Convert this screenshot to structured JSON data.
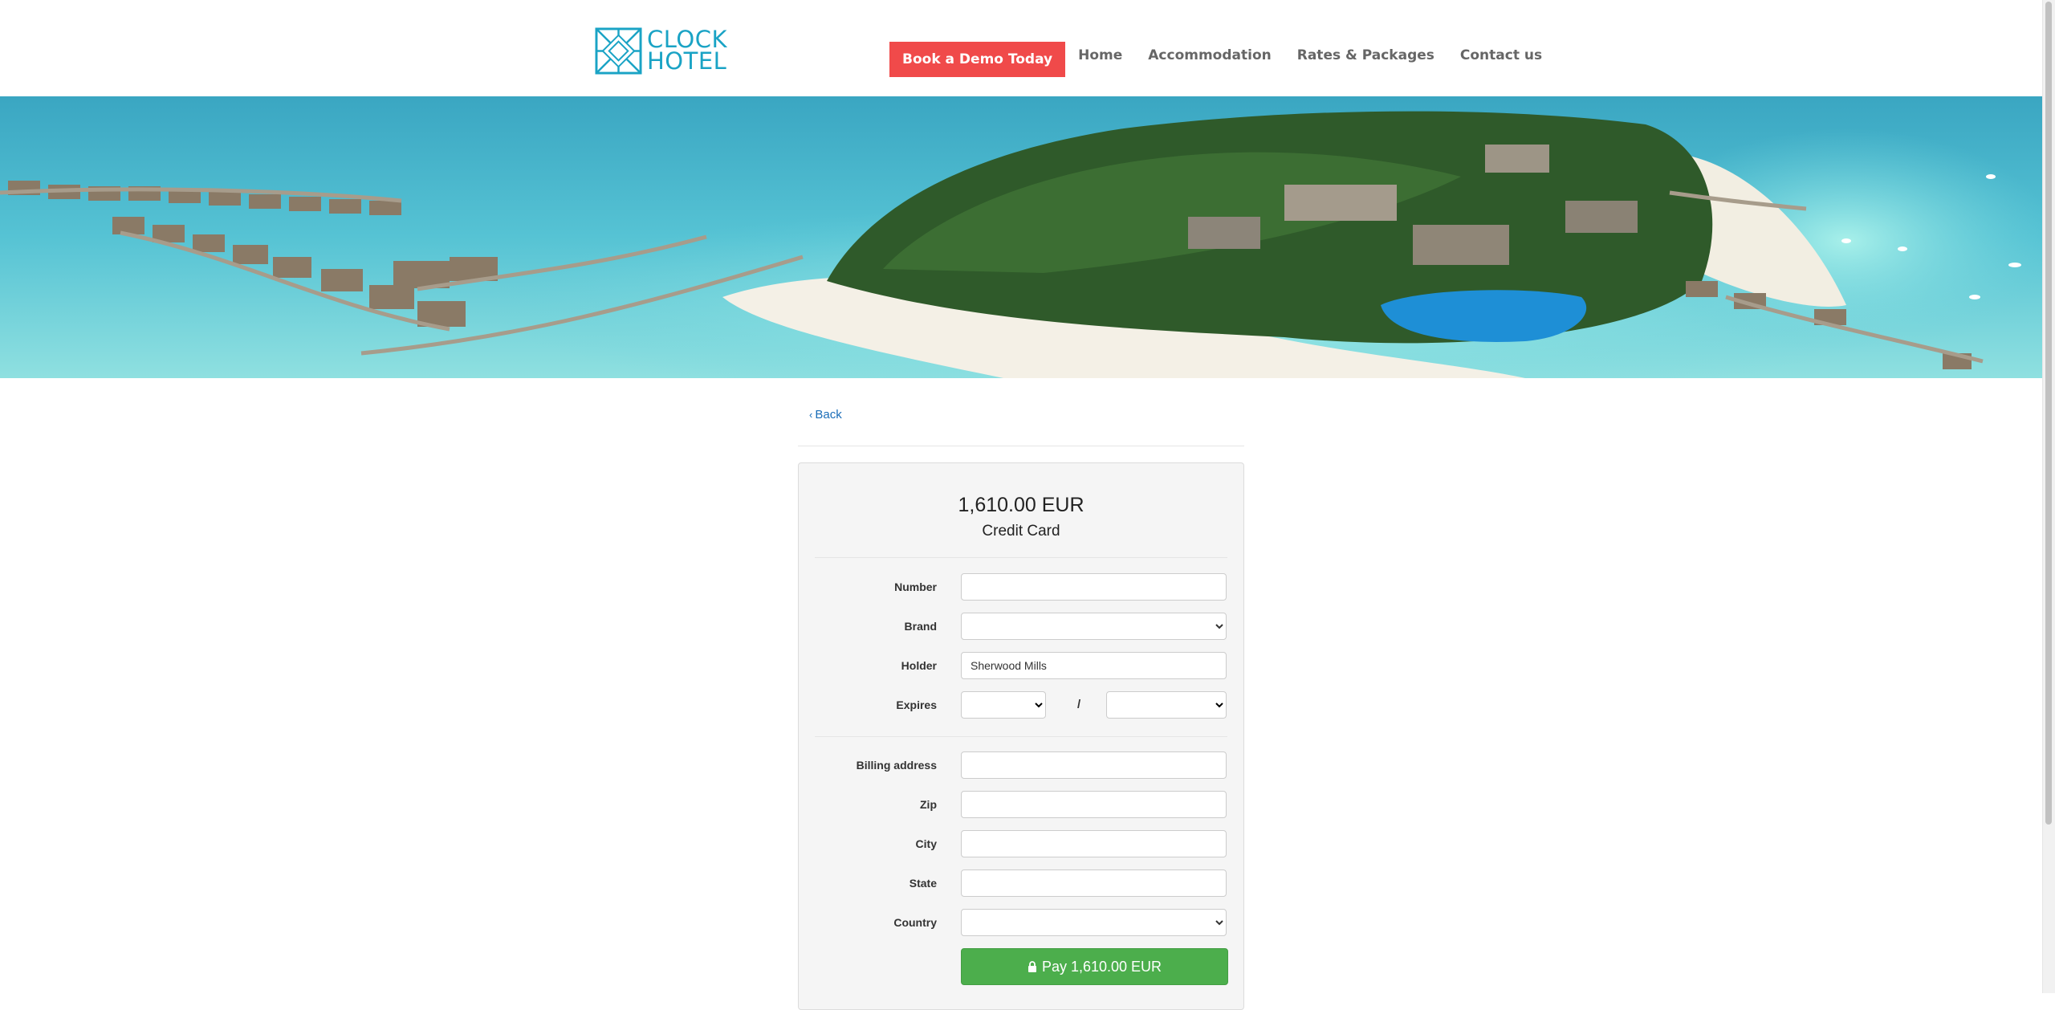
{
  "brand": {
    "logo_text_line1": "CLOCK",
    "logo_text_line2": "HOTEL",
    "color": "#1aa3c5"
  },
  "nav": {
    "demo_label": "Book a Demo Today",
    "demo_color": "#f04a4a",
    "links": [
      "Home",
      "Accommodation",
      "Rates & Packages",
      "Contact us"
    ]
  },
  "back_label": "Back",
  "payment": {
    "amount": "1,610.00 EUR",
    "method": "Credit Card",
    "fields": {
      "number_label": "Number",
      "number_value": "",
      "brand_label": "Brand",
      "brand_value": "",
      "holder_label": "Holder",
      "holder_value": "Sherwood Mills",
      "expires_label": "Expires",
      "expires_separator": "/",
      "expires_month": "",
      "expires_year": "",
      "billing_label": "Billing address",
      "billing_value": "",
      "zip_label": "Zip",
      "zip_value": "",
      "city_label": "City",
      "city_value": "",
      "state_label": "State",
      "state_value": "",
      "country_label": "Country",
      "country_value": ""
    },
    "pay_label": "Pay 1,610.00 EUR",
    "pay_color": "#4cae4c"
  }
}
